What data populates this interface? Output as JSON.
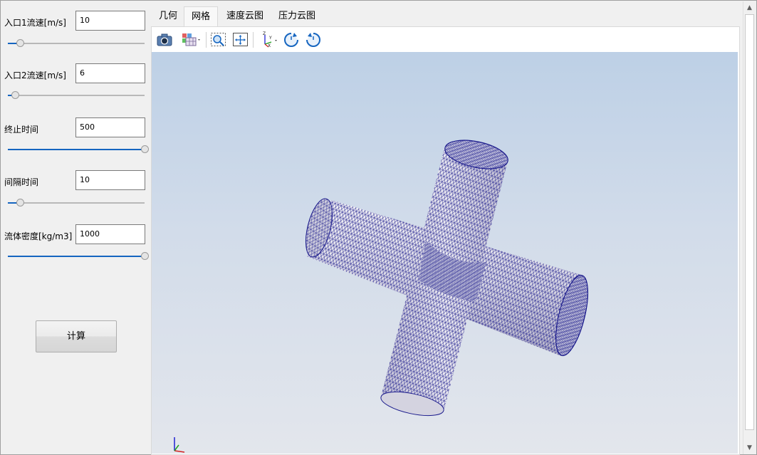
{
  "left_panel": {
    "fields": [
      {
        "label": "入口1流速[m/s]",
        "value": "10",
        "slider_level": 0.09
      },
      {
        "label": "入口2流速[m/s]",
        "value": "6",
        "slider_level": 0.05
      },
      {
        "label": "终止时间",
        "value": "500",
        "slider_level": 1.0
      },
      {
        "label": "间隔时间",
        "value": "10",
        "slider_level": 0.09
      },
      {
        "label": "流体密度[kg/m3]",
        "value": "1000",
        "slider_level": 1.0
      }
    ],
    "calc_button": "计算"
  },
  "tabs": [
    {
      "label": "几何",
      "active": false
    },
    {
      "label": "网格",
      "active": true
    },
    {
      "label": "速度云图",
      "active": false
    },
    {
      "label": "压力云图",
      "active": false
    }
  ],
  "toolbar": {
    "icons": [
      "camera-icon",
      "display-mode-icon",
      "zoom-box-icon",
      "fit-view-icon",
      "axes-orientation-icon",
      "rotate-clockwise-icon",
      "rotate-counterclockwise-icon"
    ]
  },
  "viewport": {
    "mesh_color": "#1a1a8c",
    "surface_color": "#e7e6ef",
    "axis_colors": {
      "x": "#d22020",
      "y": "#20a020",
      "z": "#2020d2"
    }
  },
  "colors": {
    "accent": "#1565c0"
  }
}
